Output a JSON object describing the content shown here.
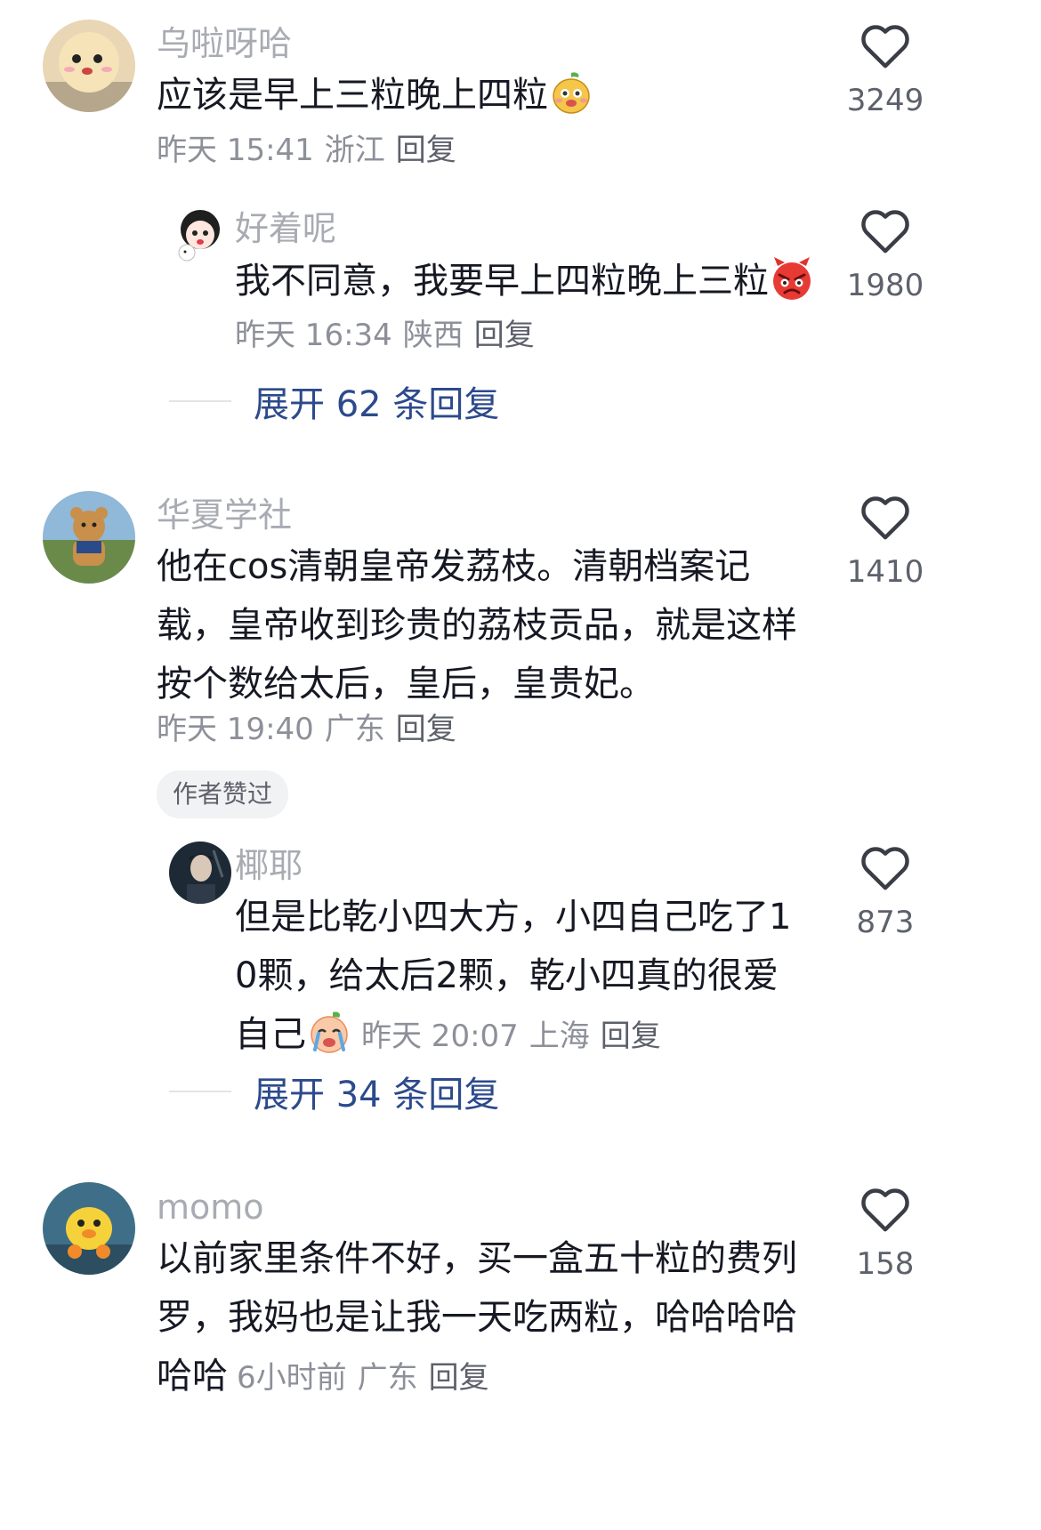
{
  "comments": [
    {
      "username": "乌啦呀哈",
      "text": "应该是早上三粒晚上四粒",
      "date": "昨天 15:41",
      "location": "浙江",
      "reply_label": "回复",
      "likes": "3249",
      "emoji": "pear-face-emoji",
      "replies": [
        {
          "username": "好着呢",
          "text": "我不同意，我要早上四粒晚上三粒",
          "date": "昨天 16:34",
          "location": "陕西",
          "reply_label": "回复",
          "likes": "1980",
          "emoji": "angry-face-emoji"
        }
      ],
      "expand_label": "展开 62 条回复"
    },
    {
      "username": "华夏学社",
      "text": "他在cos清朝皇帝发荔枝。清朝档案记载，皇帝收到珍贵的荔枝贡品，就是这样按个数给太后，皇后，皇贵妃。",
      "date": "昨天 19:40",
      "location": "广东",
      "reply_label": "回复",
      "likes": "1410",
      "badge": "作者赞过",
      "replies": [
        {
          "username": "椰耶",
          "text": "但是比乾小四大方，小四自己吃了10颗，给太后2颗，乾小四真的很爱自己",
          "date": "昨天 20:07",
          "location": "上海",
          "reply_label": "回复",
          "likes": "873",
          "emoji": "crying-face-emoji"
        }
      ],
      "expand_label": "展开 34 条回复"
    },
    {
      "username": "momo",
      "text": "以前家里条件不好，买一盒五十粒的费列罗，我妈也是让我一天吃两粒，哈哈哈哈哈哈",
      "date": "6小时前",
      "location": "广东",
      "reply_label": "回复",
      "likes": "158"
    }
  ],
  "colors": {
    "username": "#a8abb2",
    "text": "#161823",
    "meta": "#8d9099",
    "expand": "#2c4a8c",
    "badge_bg": "#f1f2f3"
  }
}
